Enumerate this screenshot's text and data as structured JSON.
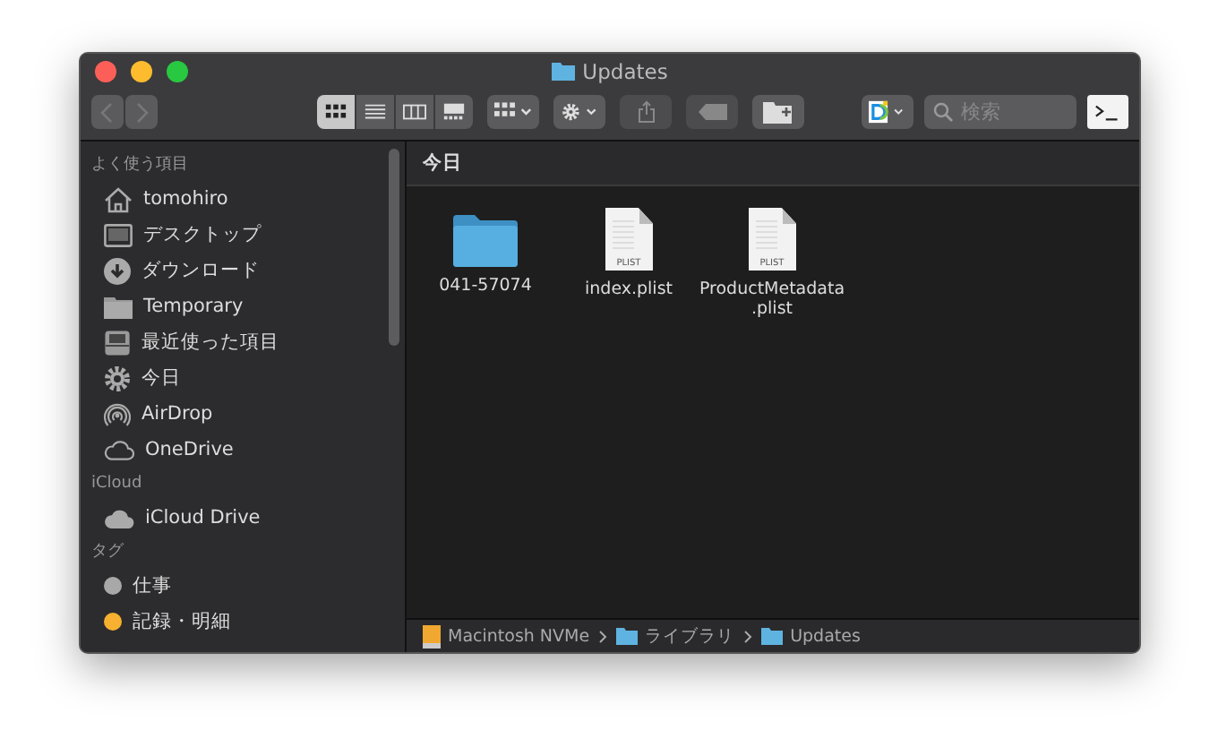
{
  "window": {
    "title": "Updates"
  },
  "toolbar": {
    "view_modes": [
      {
        "kind": "icons",
        "selected": true
      },
      {
        "kind": "list",
        "selected": false
      },
      {
        "kind": "columns",
        "selected": false
      },
      {
        "kind": "gallery",
        "selected": false
      }
    ],
    "search": {
      "placeholder": "検索"
    }
  },
  "sidebar": {
    "sections": [
      {
        "title": "よく使う項目",
        "items": [
          {
            "kind": "home",
            "label": "tomohiro"
          },
          {
            "kind": "desktop",
            "label": "デスクトップ"
          },
          {
            "kind": "download",
            "label": "ダウンロード"
          },
          {
            "kind": "folder",
            "label": "Temporary"
          },
          {
            "kind": "recent",
            "label": "最近使った項目"
          },
          {
            "kind": "gear",
            "label": "今日"
          },
          {
            "kind": "airdrop",
            "label": "AirDrop"
          },
          {
            "kind": "cloud-outline",
            "label": "OneDrive"
          }
        ]
      },
      {
        "title": "iCloud",
        "items": [
          {
            "kind": "cloud",
            "label": "iCloud Drive"
          }
        ]
      },
      {
        "title": "タグ",
        "items": [
          {
            "kind": "tag",
            "label": "仕事",
            "color": "#a8a8a8"
          },
          {
            "kind": "tag",
            "label": "記録・明細",
            "color": "#f7b02f"
          }
        ]
      }
    ]
  },
  "content": {
    "group_title": "今日",
    "files": [
      {
        "kind": "folder",
        "name": "041-57074"
      },
      {
        "kind": "document",
        "name": "index.plist",
        "icon_label": "PLIST"
      },
      {
        "kind": "document",
        "name": "ProductMetadata\n.plist",
        "icon_label": "PLIST"
      }
    ]
  },
  "path_bar": [
    {
      "kind": "disk",
      "label": "Macintosh NVMe"
    },
    {
      "kind": "folder",
      "label": "ライブラリ"
    },
    {
      "kind": "folder",
      "label": "Updates"
    }
  ]
}
